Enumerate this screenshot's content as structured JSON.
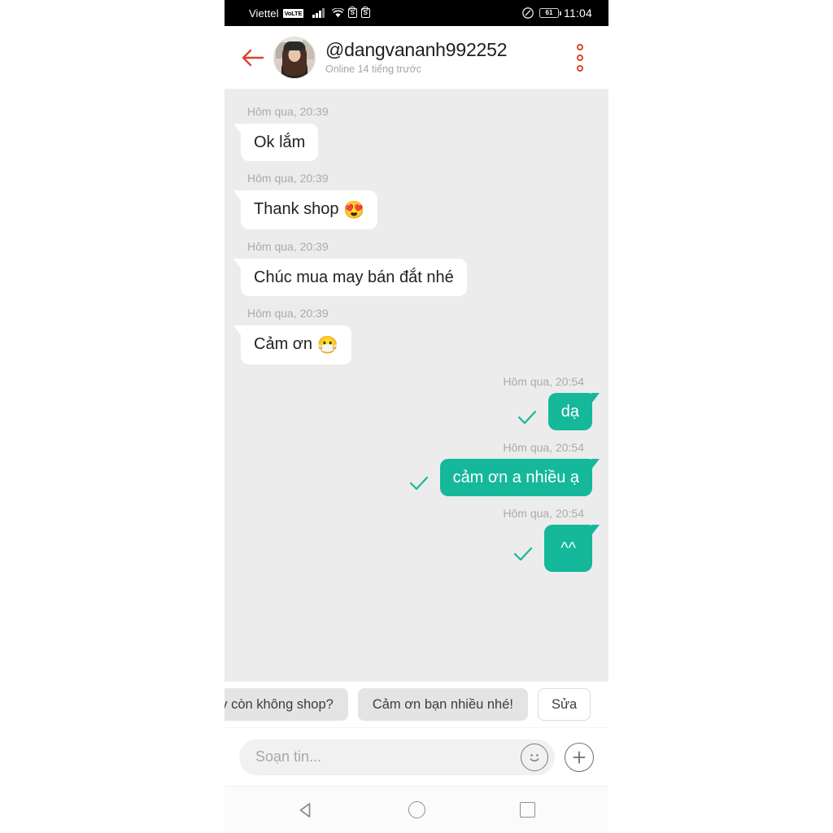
{
  "status_bar": {
    "carrier": "Viettel",
    "network_badge": "VoLTE",
    "app_icon_1": "shopee-icon",
    "app_icon_2": "shopee-icon",
    "battery_level": "61",
    "time": "11:04"
  },
  "header": {
    "back_icon": "back-arrow-icon",
    "avatar_alt": "user-avatar",
    "username": "@dangvananh992252",
    "status": "Online 14 tiếng trước",
    "more_icon": "more-vertical-icon"
  },
  "messages": [
    {
      "direction": "in",
      "timestamp": "Hôm qua, 20:39",
      "text": "Ok lắm",
      "emoji": ""
    },
    {
      "direction": "in",
      "timestamp": "Hôm qua, 20:39",
      "text": "Thank shop",
      "emoji": "😍"
    },
    {
      "direction": "in",
      "timestamp": "Hôm qua, 20:39",
      "text": "Chúc mua may bán đắt nhé",
      "emoji": ""
    },
    {
      "direction": "in",
      "timestamp": "Hôm qua, 20:39",
      "text": "Cảm ơn",
      "emoji": "😷"
    },
    {
      "direction": "out",
      "timestamp": "Hôm qua, 20:54",
      "text": "dạ",
      "emoji": "",
      "delivered": true
    },
    {
      "direction": "out",
      "timestamp": "Hôm qua, 20:54",
      "text": "cảm ơn a nhiều ạ",
      "emoji": "",
      "delivered": true
    },
    {
      "direction": "out",
      "timestamp": "Hôm qua, 20:54",
      "text": "^^",
      "emoji": "",
      "delivered": true
    }
  ],
  "suggestions": [
    {
      "label": "ón này còn không shop?",
      "style": "filled"
    },
    {
      "label": "Cảm ơn bạn nhiều nhé!",
      "style": "filled"
    },
    {
      "label": "Sửa",
      "style": "outline"
    }
  ],
  "composer": {
    "placeholder": "Soạn tin...",
    "value": "",
    "emoji_icon": "smiley-face-icon",
    "add_icon": "plus-circle-icon"
  },
  "navbar": {
    "back_icon": "nav-back-triangle-icon",
    "home_icon": "nav-home-circle-icon",
    "recents_icon": "nav-recents-square-icon"
  },
  "colors": {
    "accent_green": "#15b89a",
    "accent_red": "#d8452b",
    "chat_bg": "#ececec",
    "bubble_in": "#ffffff",
    "chip_bg": "#e4e4e4"
  }
}
